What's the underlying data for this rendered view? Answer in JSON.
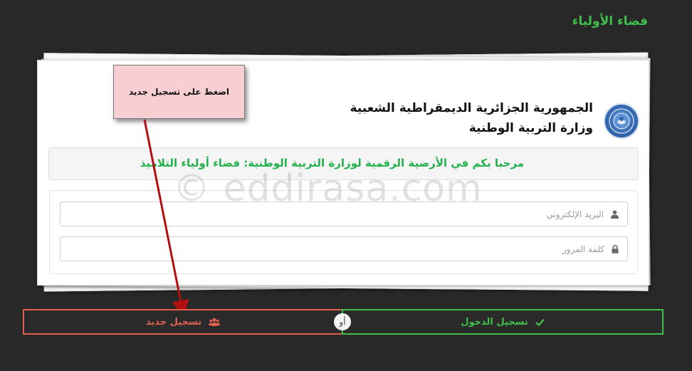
{
  "header": {
    "title": "فضاء الأولياء"
  },
  "card": {
    "gov_line1": "الجمهورية الجزائرية الديمقراطية الشعبية",
    "gov_line2": "وزارة التربية الوطنية",
    "welcome": "مرحبا بكم في الأرضية الرقمية لوزارة التربية الوطنية: فضاء أولياء التلاميذ"
  },
  "form": {
    "email": {
      "placeholder": "البريد الإلكتروني",
      "value": "",
      "icon": "user-icon"
    },
    "password": {
      "placeholder": "كلمة المرور",
      "value": "",
      "icon": "lock-icon"
    }
  },
  "annotation": {
    "note": "اضغط على تسجيل جديد"
  },
  "watermark": "© eddirasa.com",
  "buttons": {
    "register": {
      "label": "تسجيل جديد",
      "icon": "users-icon",
      "color": "#e0604e"
    },
    "or": "أو",
    "login": {
      "label": "تسجيل الدخول",
      "icon": "check-icon",
      "color": "#3fbf4a"
    }
  },
  "colors": {
    "background": "#282828",
    "accent_green": "#3fbf4a",
    "accent_red": "#e0604e",
    "note_bg": "#f7cfd3"
  }
}
